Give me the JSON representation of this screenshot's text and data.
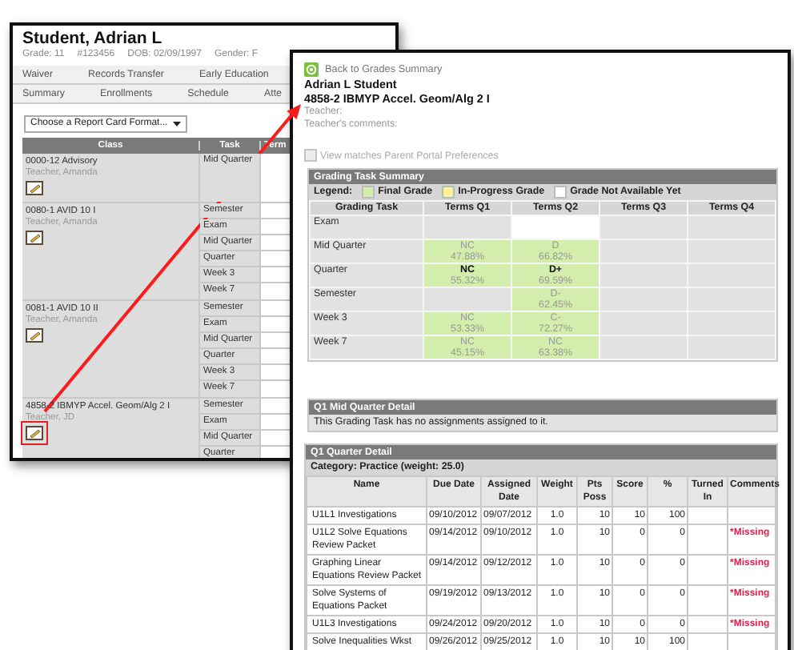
{
  "student_window": {
    "title": "Student, Adrian L",
    "info": [
      "Grade: 11",
      "#123456",
      "DOB: 02/09/1997",
      "Gender: F"
    ],
    "tab_rows": [
      [
        {
          "label": "Waiver",
          "selected": false
        },
        {
          "label": "Records Transfer",
          "selected": false
        },
        {
          "label": "Early Education",
          "selected": false
        }
      ],
      [
        {
          "label": "Summary",
          "selected": false
        },
        {
          "label": "Enrollments",
          "selected": false
        },
        {
          "label": "Schedule",
          "selected": false
        },
        {
          "label": "Atte",
          "selected": false
        }
      ]
    ],
    "report_card_format": {
      "value": "Choose a Report Card Format..."
    },
    "classes_table": {
      "columns": [
        "Class",
        "Task",
        "Term"
      ],
      "classes": [
        {
          "name": "0000-12 Advisory",
          "teacher": "Teacher, Amanda",
          "highlighted": false,
          "tasks": [
            "Mid Quarter"
          ]
        },
        {
          "name": "0080-1 AVID 10 I",
          "teacher": "Teacher, Amanda",
          "highlighted": false,
          "tasks": [
            "Semester",
            "Exam",
            "Mid Quarter",
            "Quarter",
            "Week 3",
            "Week 7"
          ]
        },
        {
          "name": "0081-1 AVID 10 II",
          "teacher": "Teacher, Amanda",
          "highlighted": false,
          "tasks": [
            "Semester",
            "Exam",
            "Mid Quarter",
            "Quarter",
            "Week 3",
            "Week 7"
          ]
        },
        {
          "name": "4858-2 IBMYP Accel. Geom/Alg 2 I",
          "teacher": "Teacher, JD",
          "highlighted": true,
          "tasks": [
            "Semester",
            "Exam",
            "Mid Quarter",
            "Quarter"
          ]
        }
      ]
    }
  },
  "grade_detail": {
    "back_link": "Back to Grades Summary",
    "student": "Adrian L Student",
    "course": "4858-2 IBMYP Accel. Geom/Alg 2 I",
    "teacher_label": "Teacher:",
    "comments_label": "Teacher's comments:",
    "parent_portal": {
      "label": "View matches Parent Portal Preferences",
      "checked": false,
      "disabled": true
    },
    "grading_summary": {
      "title": "Grading Task Summary",
      "legend_label": "Legend:",
      "legend": [
        {
          "label": "Final Grade",
          "color": "#d3edac"
        },
        {
          "label": "In-Progress Grade",
          "color": "#fbf19a"
        },
        {
          "label": "Grade Not Available Yet",
          "color": "#ffffff"
        }
      ],
      "columns": [
        "Grading Task",
        "Terms Q1",
        "Terms Q2",
        "Terms Q3",
        "Terms Q4"
      ],
      "rows": [
        {
          "cells": [
            {
              "kind": "task",
              "text": "Exam"
            },
            {
              "kind": "empty"
            },
            {
              "kind": "not_available"
            },
            {
              "kind": "empty"
            },
            {
              "kind": "empty"
            }
          ]
        },
        {
          "cells": [
            {
              "kind": "task",
              "text": "Mid Quarter"
            },
            {
              "kind": "final",
              "grade": "NC",
              "percent": "47.88%",
              "posted": false
            },
            {
              "kind": "final",
              "grade": "D",
              "percent": "66.82%",
              "posted": false
            },
            {
              "kind": "empty"
            },
            {
              "kind": "empty"
            }
          ]
        },
        {
          "cells": [
            {
              "kind": "task",
              "text": "Quarter"
            },
            {
              "kind": "final",
              "grade": "NC",
              "percent": "55.32%",
              "posted": true
            },
            {
              "kind": "final",
              "grade": "D+",
              "percent": "69.59%",
              "posted": true
            },
            {
              "kind": "empty"
            },
            {
              "kind": "empty"
            }
          ]
        },
        {
          "cells": [
            {
              "kind": "task",
              "text": "Semester"
            },
            {
              "kind": "empty"
            },
            {
              "kind": "final",
              "grade": "D-",
              "percent": "62.45%",
              "posted": false
            },
            {
              "kind": "empty"
            },
            {
              "kind": "empty"
            }
          ]
        },
        {
          "cells": [
            {
              "kind": "task",
              "text": "Week 3"
            },
            {
              "kind": "final",
              "grade": "NC",
              "percent": "53.33%",
              "posted": false
            },
            {
              "kind": "final",
              "grade": "C-",
              "percent": "72.27%",
              "posted": false
            },
            {
              "kind": "empty"
            },
            {
              "kind": "empty"
            }
          ]
        },
        {
          "cells": [
            {
              "kind": "task",
              "text": "Week 7"
            },
            {
              "kind": "final",
              "grade": "NC",
              "percent": "45.15%",
              "posted": false
            },
            {
              "kind": "final",
              "grade": "NC",
              "percent": "63.38%",
              "posted": false
            },
            {
              "kind": "empty"
            },
            {
              "kind": "empty"
            }
          ]
        }
      ]
    },
    "mid_quarter_detail": {
      "title": "Q1 Mid Quarter Detail",
      "message": "This Grading Task has no assignments assigned to it."
    },
    "quarter_detail": {
      "title": "Q1 Quarter Detail",
      "category": "Category: Practice (weight: 25.0)",
      "columns": [
        "Name",
        "Due Date",
        "Assigned Date",
        "Weight",
        "Pts Poss",
        "Score",
        "%",
        "Turned In",
        "Comments"
      ],
      "rows": [
        {
          "name": "U1L1 Investigations",
          "due": "09/10/2012",
          "assigned": "09/07/2012",
          "weight": "1.0",
          "pts_poss": "10",
          "score": "10",
          "percent": "100"
        },
        {
          "name": "U1L2 Solve Equations Review Packet",
          "due": "09/14/2012",
          "assigned": "09/10/2012",
          "weight": "1.0",
          "pts_poss": "10",
          "score": "0",
          "percent": "0",
          "comments": "*Missing"
        },
        {
          "name": "Graphing Linear Equations Review Packet",
          "due": "09/14/2012",
          "assigned": "09/12/2012",
          "weight": "1.0",
          "pts_poss": "10",
          "score": "0",
          "percent": "0",
          "comments": "*Missing"
        },
        {
          "name": "Solve Systems of Equations Packet",
          "due": "09/19/2012",
          "assigned": "09/13/2012",
          "weight": "1.0",
          "pts_poss": "10",
          "score": "0",
          "percent": "0",
          "comments": "*Missing"
        },
        {
          "name": "U1L3 Investigations",
          "due": "09/24/2012",
          "assigned": "09/20/2012",
          "weight": "1.0",
          "pts_poss": "10",
          "score": "0",
          "percent": "0",
          "comments": "*Missing"
        },
        {
          "name": "Solve Inequalities Wkst",
          "due": "09/26/2012",
          "assigned": "09/25/2012",
          "weight": "1.0",
          "pts_poss": "10",
          "score": "10",
          "percent": "100"
        }
      ]
    }
  }
}
